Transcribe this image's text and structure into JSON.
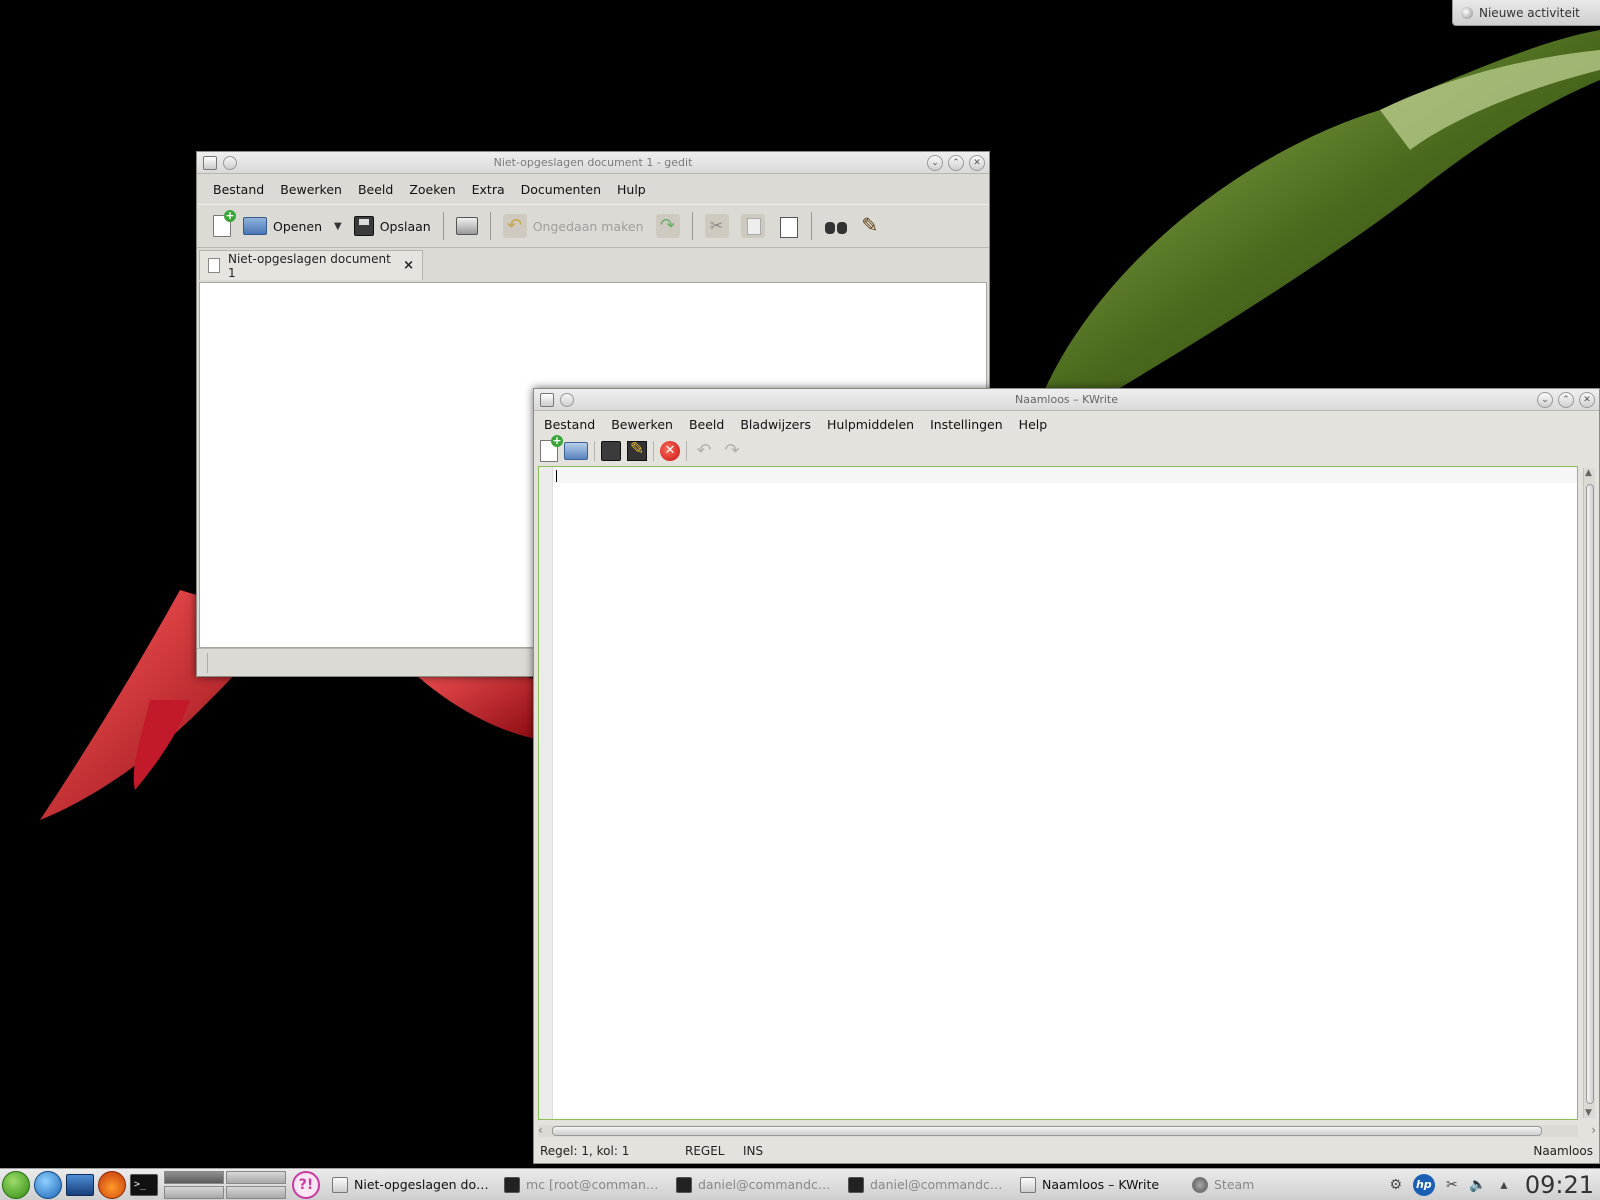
{
  "desktop": {
    "activity_button": "Nieuwe activiteit"
  },
  "gedit": {
    "title": "Niet-opgeslagen document 1 - gedit",
    "menu": [
      "Bestand",
      "Bewerken",
      "Beeld",
      "Zoeken",
      "Extra",
      "Documenten",
      "Hulp"
    ],
    "toolbar": {
      "open": "Openen",
      "save": "Opslaan",
      "undo": "Ongedaan maken"
    },
    "tab": {
      "label": "Niet-opgeslagen document 1",
      "close": "×"
    }
  },
  "kwrite": {
    "title": "Naamloos – KWrite",
    "menu": [
      "Bestand",
      "Bewerken",
      "Beeld",
      "Bladwijzers",
      "Hulpmiddelen",
      "Instellingen",
      "Help"
    ],
    "status": {
      "position": "Regel: 1, kol: 1",
      "mode": "REGEL",
      "insert": "INS",
      "filename": "Naamloos"
    }
  },
  "taskbar": {
    "tasks": [
      {
        "label": "Niet-opgeslagen docum",
        "icon": "text-editor-icon",
        "active": true
      },
      {
        "label": "mc [root@commandchai",
        "icon": "terminal-icon",
        "active": false
      },
      {
        "label": "daniel@commandchair",
        "icon": "terminal-icon",
        "active": false
      },
      {
        "label": "daniel@commandchair",
        "icon": "terminal-icon",
        "active": false
      },
      {
        "label": "Naamloos – KWrite",
        "icon": "text-editor-icon",
        "active": true
      },
      {
        "label": "Steam",
        "icon": "steam-icon",
        "active": false
      }
    ],
    "clock": "09:21"
  }
}
